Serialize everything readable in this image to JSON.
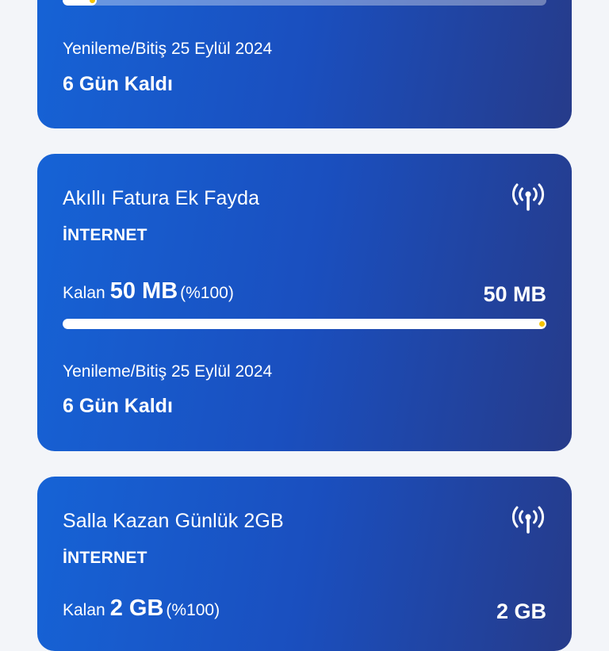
{
  "cards": [
    {
      "usage_fraction": 0.07,
      "renewal": "Yenileme/Bitiş 25 Eylül 2024",
      "days_left": "6 Gün Kaldı"
    },
    {
      "title": "Akıllı Fatura Ek Fayda",
      "category": "İNTERNET",
      "remaining_prefix": "Kalan",
      "remaining_amount": "50 MB",
      "remaining_percent": "(%100)",
      "total": "50 MB",
      "usage_fraction": 1.0,
      "renewal": "Yenileme/Bitiş 25 Eylül 2024",
      "days_left": "6 Gün Kaldı"
    },
    {
      "title": "Salla Kazan Günlük 2GB",
      "category": "İNTERNET",
      "remaining_prefix": "Kalan",
      "remaining_amount": "2 GB",
      "remaining_percent": "(%100)",
      "total": "2 GB"
    }
  ],
  "colors": {
    "card_gradient_start": "#1663d6",
    "card_gradient_end": "#263b8a",
    "bar_fill": "#ffffff",
    "bar_marker": "#f5c400",
    "background": "#f3f5f9"
  },
  "icons": {
    "package_type": "signal-antenna-icon"
  }
}
